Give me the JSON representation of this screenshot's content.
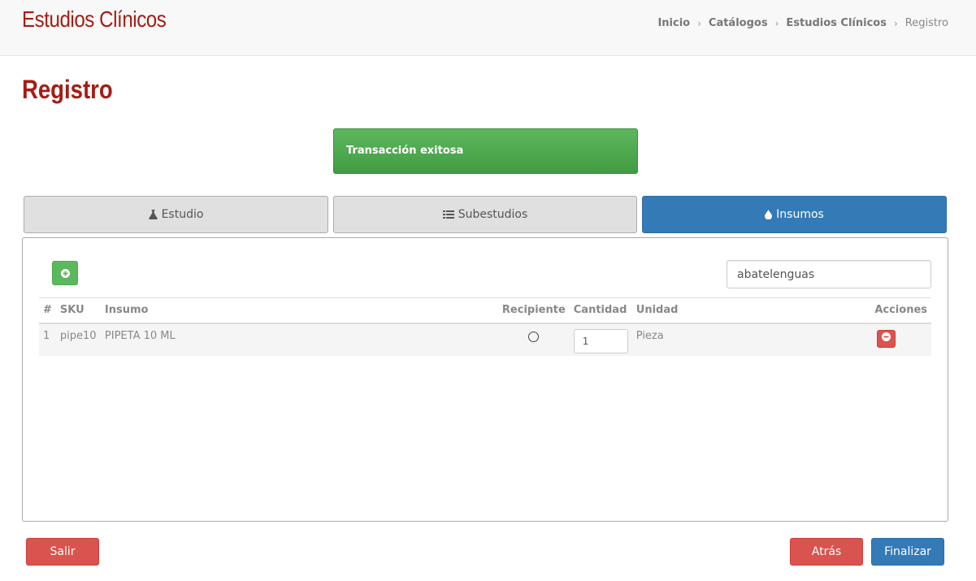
{
  "header": {
    "app_title": "Estudios Clínicos",
    "breadcrumb": [
      {
        "label": "Inicio"
      },
      {
        "label": "Catálogos"
      },
      {
        "label": "Estudios Clínicos"
      },
      {
        "label": "Registro"
      }
    ]
  },
  "page_title": "Registro",
  "alert": {
    "message": "Transacción exitosa",
    "color": "#5cb85c"
  },
  "tabs": [
    {
      "label": "Estudio",
      "icon": "flask-icon",
      "active": false
    },
    {
      "label": "Subestudios",
      "icon": "list-icon",
      "active": false
    },
    {
      "label": "Insumos",
      "icon": "tint-icon",
      "active": true
    }
  ],
  "insumos": {
    "search_value": "abatelenguas",
    "columns": [
      "#",
      "SKU",
      "Insumo",
      "Recipiente",
      "Cantidad",
      "Unidad",
      "Acciones"
    ],
    "rows": [
      {
        "num": "1",
        "sku": "pipe10",
        "insumo": "PIPETA 10 ML",
        "recipiente_selected": false,
        "cantidad": "1",
        "unidad": "Pieza"
      }
    ]
  },
  "footer": {
    "salir_label": "Salir",
    "atras_label": "Atrás",
    "finalizar_label": "Finalizar"
  },
  "colors": {
    "brand": "#a61c14",
    "primary": "#337ab7",
    "success": "#5cb85c",
    "danger": "#d9534f"
  }
}
